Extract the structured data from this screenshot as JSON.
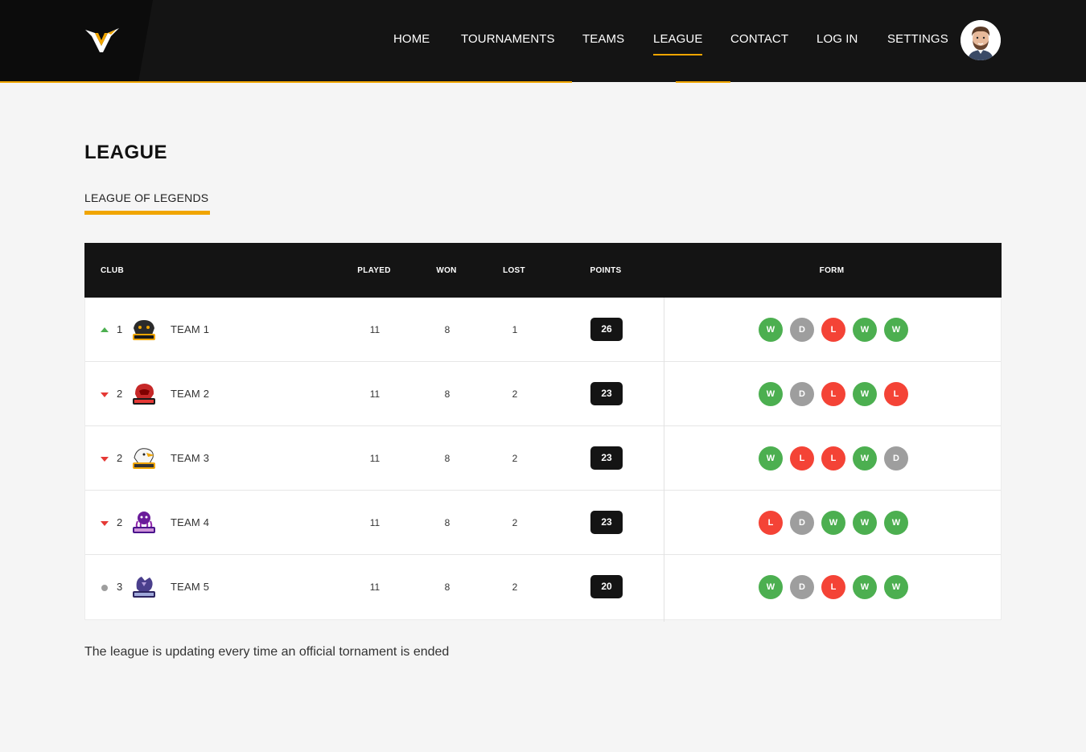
{
  "header": {
    "nav": [
      {
        "label": "HOME"
      },
      {
        "label": "TOURNAMENTS"
      },
      {
        "label": "TEAMS"
      },
      {
        "label": "LEAGUE",
        "active": true
      },
      {
        "label": "CONTACT"
      },
      {
        "label": "LOG IN"
      },
      {
        "label": "SETTINGS"
      }
    ]
  },
  "page": {
    "title": "LEAGUE",
    "tab": "LEAGUE OF LEGENDS"
  },
  "table": {
    "columns": {
      "club": "CLUB",
      "played": "PLAYED",
      "won": "WON",
      "lost": "LOST",
      "points": "POINTS",
      "form": "FORM"
    },
    "rows": [
      {
        "trend": "up",
        "rank": "1",
        "team": "TEAM 1",
        "logo": "panthers-logo",
        "played": "11",
        "won": "8",
        "lost": "1",
        "points": "26",
        "form": [
          "W",
          "D",
          "L",
          "W",
          "W"
        ]
      },
      {
        "trend": "down",
        "rank": "2",
        "team": "TEAM 2",
        "logo": "red-team-logo",
        "played": "11",
        "won": "8",
        "lost": "2",
        "points": "23",
        "form": [
          "W",
          "D",
          "L",
          "W",
          "L"
        ]
      },
      {
        "trend": "down",
        "rank": "2",
        "team": "TEAM 3",
        "logo": "eagles-logo",
        "played": "11",
        "won": "8",
        "lost": "2",
        "points": "23",
        "form": [
          "W",
          "L",
          "L",
          "W",
          "D"
        ]
      },
      {
        "trend": "down",
        "rank": "2",
        "team": "TEAM 4",
        "logo": "octopus-logo",
        "played": "11",
        "won": "8",
        "lost": "2",
        "points": "23",
        "form": [
          "L",
          "D",
          "W",
          "W",
          "W"
        ]
      },
      {
        "trend": "same",
        "rank": "3",
        "team": "TEAM 5",
        "logo": "dragons-logo",
        "played": "11",
        "won": "8",
        "lost": "2",
        "points": "20",
        "form": [
          "W",
          "D",
          "L",
          "W",
          "W"
        ]
      }
    ]
  },
  "footer": {
    "note": "The league is updating every time an official tornament is ended"
  },
  "colors": {
    "accent": "#f0a500",
    "header_bg": "#141414",
    "win": "#4caf50",
    "draw": "#9e9e9e",
    "loss": "#f44336"
  }
}
